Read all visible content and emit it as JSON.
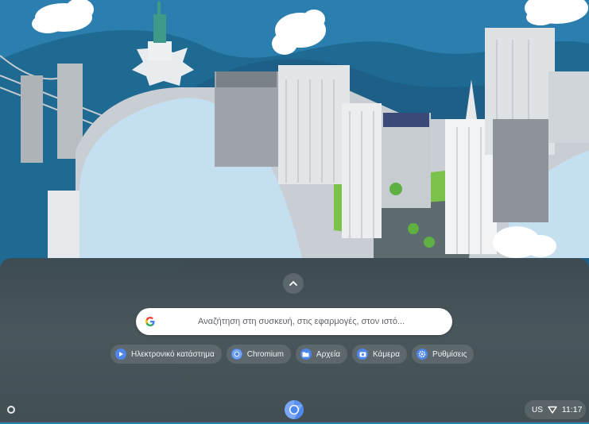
{
  "launcher": {
    "search": {
      "placeholder": "Αναζήτηση στη συσκευή, στις εφαρμογές, στον ιστό..."
    },
    "suggestions": [
      {
        "label": "Ηλεκτρονικό κατάστημα",
        "icon": "play-store-icon"
      },
      {
        "label": "Chromium",
        "icon": "chromium-icon"
      },
      {
        "label": "Αρχεία",
        "icon": "files-folder-icon"
      },
      {
        "label": "Κάμερα",
        "icon": "camera-icon"
      },
      {
        "label": "Ρυθμίσεις",
        "icon": "settings-gear-icon"
      }
    ],
    "expand_icon": "chevron-up-icon"
  },
  "shelf": {
    "home_icon": "launcher-circle-icon",
    "pinned_app_icon": "chromium-icon",
    "status": {
      "ime": "US",
      "wifi_icon": "wifi-icon",
      "time": "11:17"
    }
  },
  "colors": {
    "sky": "#2b7fae",
    "hill": "#1f6a93",
    "launcher_bg": "#4a565a",
    "chip_bg": "rgba(255,255,255,0.12)",
    "accent_blue": "#4f86ec"
  }
}
